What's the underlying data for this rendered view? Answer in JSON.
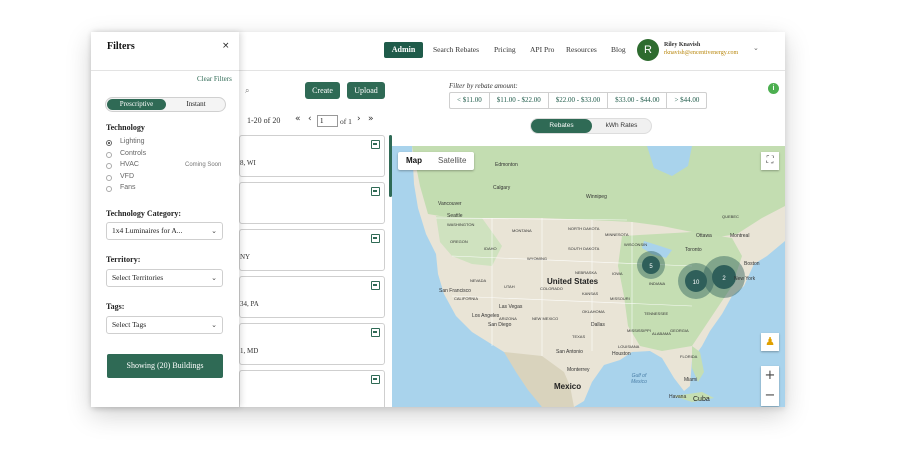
{
  "nav": {
    "admin": "Admin",
    "links": [
      "Search Rebates",
      "Pricing",
      "API Pro",
      "Resources",
      "Blog"
    ],
    "avatar_letter": "R",
    "user_name": "Riley Knavish",
    "user_email": "rknavish@encentivenergy.com"
  },
  "toolbar": {
    "create": "Create",
    "upload": "Upload",
    "filter_title": "Filter by rebate amount:",
    "price_ranges": [
      "< $11.00",
      "$11.00 - $22.00",
      "$22.00 - $33.00",
      "$33.00 - $44.00",
      "> $44.00"
    ],
    "info": "i"
  },
  "pager": {
    "range": "1-20 of 20",
    "first": "«",
    "prev": "‹",
    "page": "1",
    "of": "of 1",
    "next": "›",
    "last": "»"
  },
  "rate_toggle": {
    "active": "Rebates",
    "inactive": "kWh Rates"
  },
  "list": {
    "cards": [
      {
        "text": "8, WI"
      },
      {
        "text": ""
      },
      {
        "text": "NY"
      },
      {
        "text": "34, PA"
      },
      {
        "text": "1, MD"
      }
    ]
  },
  "map": {
    "tabs": [
      "Map",
      "Satellite"
    ],
    "labels": {
      "edmonton": "Edmonton",
      "calgary": "Calgary",
      "winnipeg": "Winnipeg",
      "vancouver": "Vancouver",
      "seattle": "Seattle",
      "ottawa": "Ottawa",
      "montreal": "Montreal",
      "toronto": "Toronto",
      "boston": "Boston",
      "newyork": "New York",
      "united_states": "United States",
      "sanfrancisco": "San Francisco",
      "lasvegas": "Las Vegas",
      "losangeles": "Los Angeles",
      "sandiego": "San Diego",
      "dallas": "Dallas",
      "houston": "Houston",
      "sanantonio": "San Antonio",
      "monterrey": "Monterrey",
      "mexico": "Mexico",
      "gulf": "Gulf of Mexico",
      "miami": "Miami",
      "havana": "Havana",
      "cuba": "Cuba",
      "nevada": "NEVADA",
      "oregon": "OREGON",
      "texas": "TEXAS",
      "wyoming": "WYOMING",
      "montana": "MONTANA",
      "new_mexico": "NEW MEXICO",
      "arizona": "ARIZONA",
      "colorado": "COLORADO",
      "kansas": "KANSAS",
      "oklahoma": "OKLAHOMA",
      "missouri": "MISSOURI",
      "iowa": "IOWA",
      "nebraska": "NEBRASKA",
      "indiana": "INDIANA",
      "georgia": "GEORGIA",
      "tennessee": "TENNESSEE",
      "wisconsin": "WISCONSIN",
      "minnesota": "MINNESOTA",
      "north_dakota": "NORTH DAKOTA",
      "south_dakota": "SOUTH DAKOTA",
      "washington": "WASHINGTON",
      "idaho": "IDAHO",
      "utah": "UTAH",
      "california": "CALIFORNIA",
      "alabama": "ALABAMA",
      "mississippi": "MISSISSIPPI",
      "louisiana": "LOUISIANA",
      "florida": "FLORIDA",
      "quebec": "QUEBEC"
    },
    "clusters": [
      {
        "count": "5"
      },
      {
        "count": "10"
      },
      {
        "count": "2"
      }
    ],
    "colors": {
      "water": "#a9d3ec",
      "land": "#e8e4d8",
      "green": "#b7d7a0",
      "cluster": "#2f5f5a"
    }
  },
  "filters": {
    "title": "Filters",
    "close": "×",
    "clear": "Clear Filters",
    "mode_active": "Prescriptive",
    "mode_inactive": "Instant",
    "technology_label": "Technology",
    "technologies": [
      {
        "label": "Lighting",
        "checked": true,
        "note": ""
      },
      {
        "label": "Controls",
        "checked": false,
        "note": ""
      },
      {
        "label": "HVAC",
        "checked": false,
        "note": "Coming Soon"
      },
      {
        "label": "VFD",
        "checked": false,
        "note": ""
      },
      {
        "label": "Fans",
        "checked": false,
        "note": ""
      }
    ],
    "category_label": "Technology Category:",
    "category_value": "1x4 Luminaires for A...",
    "territory_label": "Territory:",
    "territory_value": "Select Territories",
    "tags_label": "Tags:",
    "tags_value": "Select Tags",
    "submit": "Showing (20) Buildings"
  }
}
